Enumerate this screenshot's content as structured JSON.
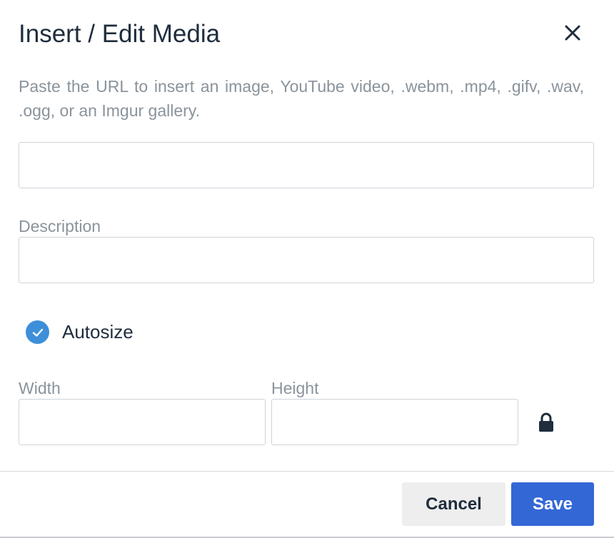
{
  "dialog": {
    "title": "Insert / Edit Media",
    "help_text": "Paste the URL to insert an image, YouTube video, .webm, .mp4, .gifv, .wav, .ogg, or an Imgur gallery."
  },
  "url_field": {
    "value": "",
    "placeholder": ""
  },
  "description_field": {
    "label": "Description",
    "value": "",
    "placeholder": ""
  },
  "autosize": {
    "label": "Autosize",
    "checked": true
  },
  "width_field": {
    "label": "Width",
    "value": "",
    "placeholder": ""
  },
  "height_field": {
    "label": "Height",
    "value": "",
    "placeholder": ""
  },
  "footer": {
    "cancel_label": "Cancel",
    "save_label": "Save"
  },
  "colors": {
    "primary": "#3367d6",
    "checkbox": "#3d8fd9",
    "muted_text": "#8a939b",
    "text": "#1f2d3d"
  },
  "icons": {
    "close": "close-icon",
    "check": "check-icon",
    "lock": "lock-icon"
  }
}
